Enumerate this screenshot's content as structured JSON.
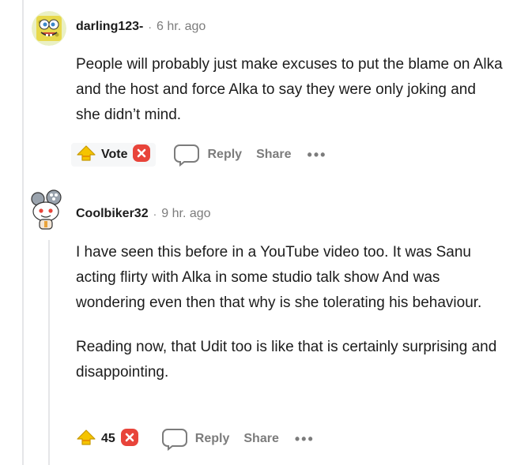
{
  "comments": [
    {
      "username": "darling123-",
      "time": "6 hr. ago",
      "paragraphs": [
        "People will probably just make excuses to put the blame on Alka and the host and force Alka to say they were only joking and she didn’t mind."
      ],
      "vote_label": "Vote",
      "reply_label": "Reply",
      "share_label": "Share",
      "more_label": "•••",
      "avatar_icon": "spongebob-avatar-icon"
    },
    {
      "username": "Coolbiker32",
      "time": "9 hr. ago",
      "paragraphs": [
        "I have seen this before in a YouTube video too. It was Sanu acting flirty with Alka in some studio talk show And was wondering even then that why is she tolerating his behaviour.",
        "Reading now, that Udit too is like that is certainly surprising and disappointing."
      ],
      "vote_label": "45",
      "reply_label": "Reply",
      "share_label": "Share",
      "more_label": "•••",
      "avatar_icon": "snoo-avatar-icon"
    }
  ],
  "separator": "·",
  "colors": {
    "upvote": "#f5c400",
    "downvote": "#e8443a",
    "muted": "#7c7c7c",
    "thread": "#e5e6e8"
  }
}
